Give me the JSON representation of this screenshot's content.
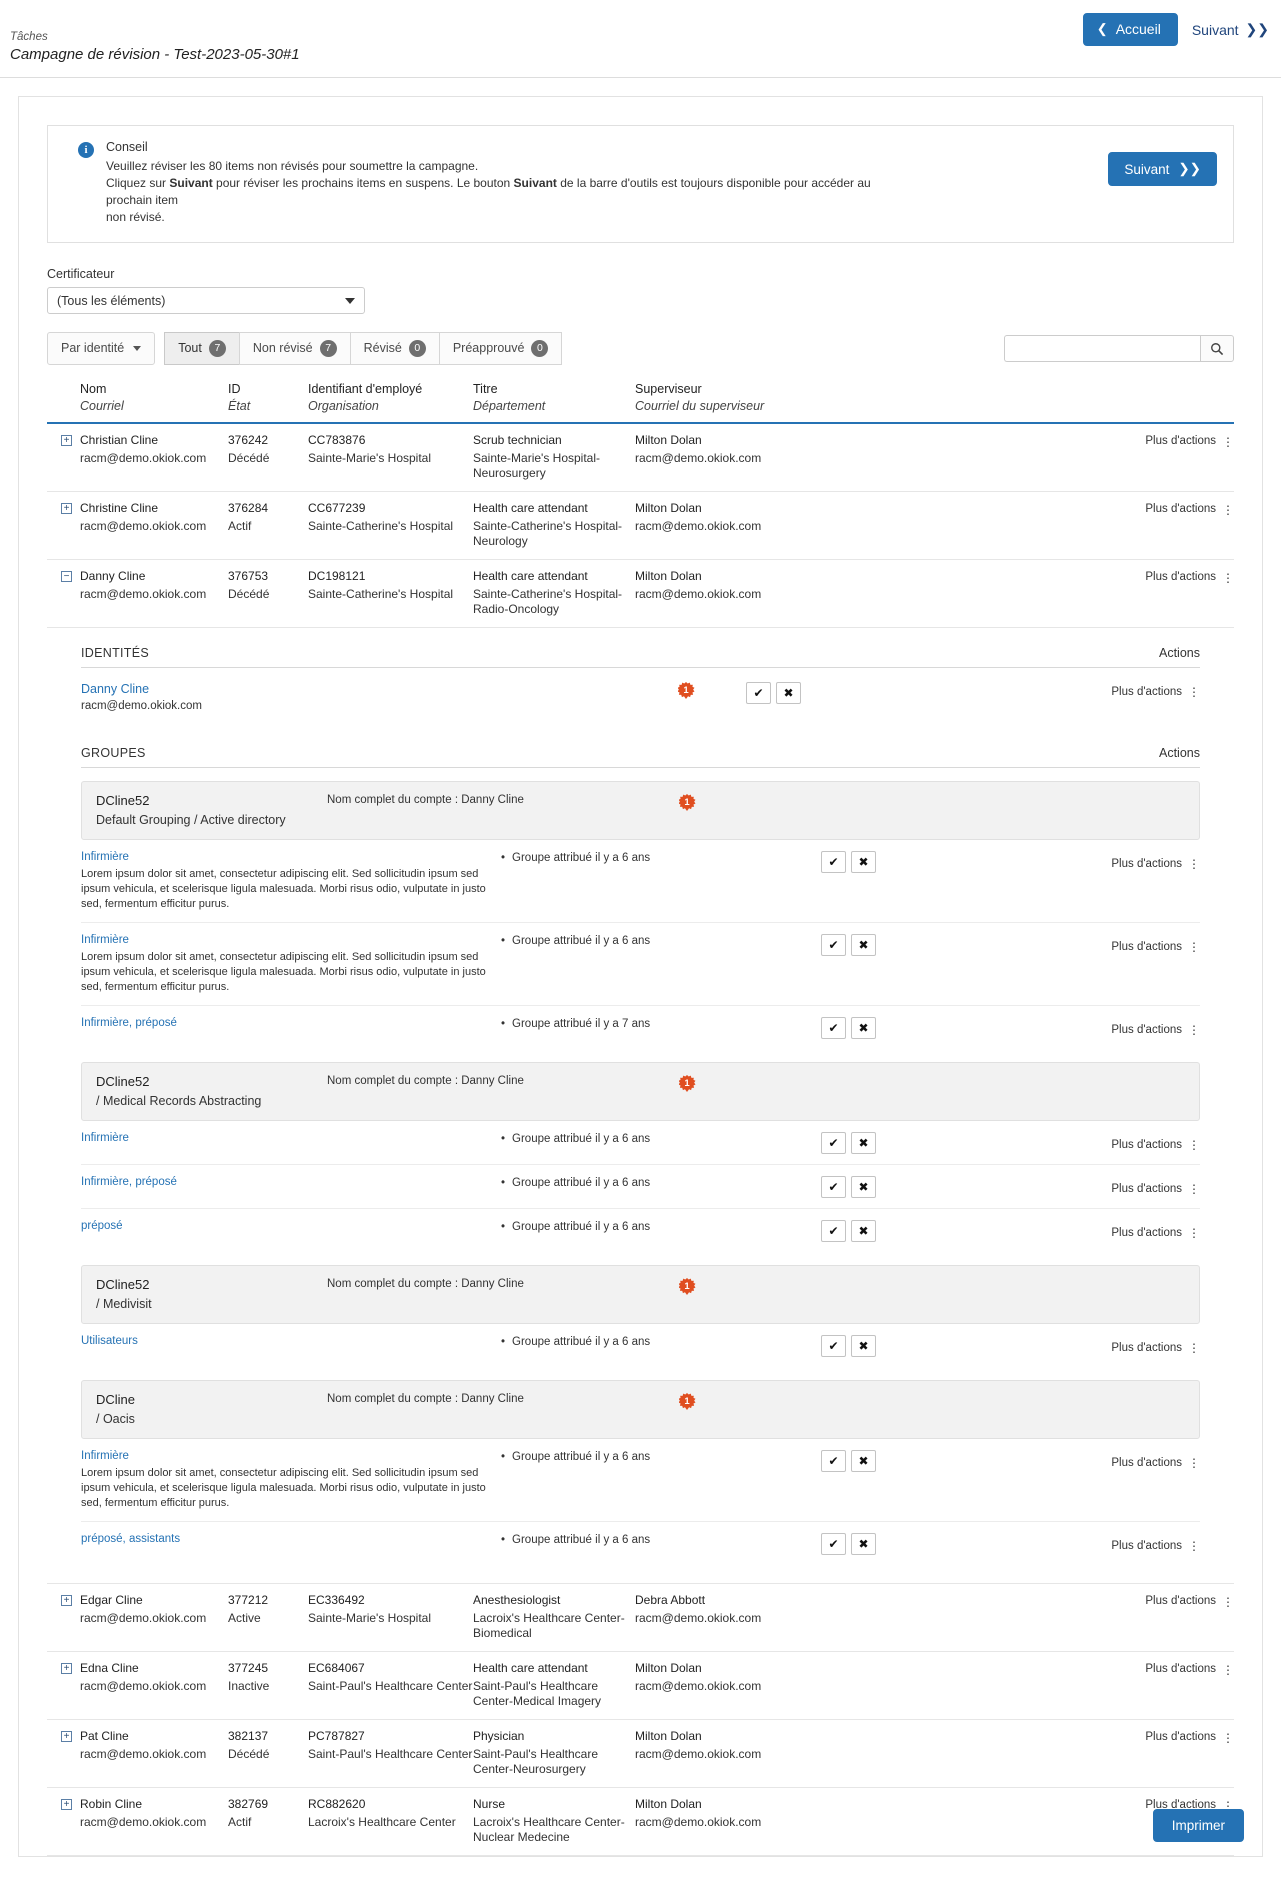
{
  "header": {
    "breadcrumb": "Tâches",
    "title": "Campagne de révision - Test-2023-05-30#1",
    "home_button": "Accueil",
    "next_link": "Suivant"
  },
  "tip": {
    "title": "Conseil",
    "line1": "Veuillez réviser les 80 items non révisés pour soumettre la campagne.",
    "line2_a": "Cliquez sur ",
    "line2_b": "Suivant",
    "line2_c": " pour réviser les prochains items en suspens. Le bouton ",
    "line2_d": "Suivant",
    "line2_e": " de la barre d'outils est toujours disponible pour accéder au prochain item",
    "line3": "non révisé.",
    "next_button": "Suivant"
  },
  "filters": {
    "certificateur_label": "Certificateur",
    "certificateur_value": "(Tous les éléments)",
    "group_tab": "Par identité",
    "tabs": [
      {
        "label": "Tout",
        "count": "7",
        "active": true
      },
      {
        "label": "Non révisé",
        "count": "7",
        "active": false
      },
      {
        "label": "Révisé",
        "count": "0",
        "active": false
      },
      {
        "label": "Préapprouvé",
        "count": "0",
        "active": false
      }
    ],
    "search_value": "",
    "search_placeholder": ""
  },
  "table": {
    "headers": {
      "nom": "Nom",
      "nom_sub": "Courriel",
      "id": "ID",
      "id_sub": "État",
      "emp": "Identifiant d'employé",
      "emp_sub": "Organisation",
      "titre": "Titre",
      "titre_sub": "Département",
      "sup": "Superviseur",
      "sup_sub": "Courriel du superviseur"
    },
    "more_actions": "Plus d'actions",
    "rows": [
      {
        "expander": "+",
        "name": "Christian Cline",
        "email": "racm@demo.okiok.com",
        "id": "376242",
        "state": "Décédé",
        "emp_id": "CC783876",
        "org": "Sainte-Marie's Hospital",
        "title": "Scrub technician",
        "dept": "Sainte-Marie's Hospital-Neurosurgery",
        "sup": "Milton Dolan",
        "sup_email": "racm@demo.okiok.com"
      },
      {
        "expander": "+",
        "name": "Christine Cline",
        "email": "racm@demo.okiok.com",
        "id": "376284",
        "state": "Actif",
        "emp_id": "CC677239",
        "org": "Sainte-Catherine's Hospital",
        "title": "Health care attendant",
        "dept": "Sainte-Catherine's Hospital-Neurology",
        "sup": "Milton Dolan",
        "sup_email": "racm@demo.okiok.com"
      },
      {
        "expander": "−",
        "name": "Danny Cline",
        "email": "racm@demo.okiok.com",
        "id": "376753",
        "state": "Décédé",
        "emp_id": "DC198121",
        "org": "Sainte-Catherine's Hospital",
        "title": "Health care attendant",
        "dept": "Sainte-Catherine's Hospital-Radio-Oncology",
        "sup": "Milton Dolan",
        "sup_email": "racm@demo.okiok.com"
      }
    ],
    "rows_after": [
      {
        "expander": "+",
        "name": "Edgar Cline",
        "email": "racm@demo.okiok.com",
        "id": "377212",
        "state": "Active",
        "emp_id": "EC336492",
        "org": "Sainte-Marie's Hospital",
        "title": "Anesthesiologist",
        "dept": "Lacroix's Healthcare Center-Biomedical",
        "sup": "Debra Abbott",
        "sup_email": "racm@demo.okiok.com"
      },
      {
        "expander": "+",
        "name": "Edna Cline",
        "email": "racm@demo.okiok.com",
        "id": "377245",
        "state": "Inactive",
        "emp_id": "EC684067",
        "org": "Saint-Paul's Healthcare Center",
        "title": "Health care attendant",
        "dept": "Saint-Paul's Healthcare Center-Medical Imagery",
        "sup": "Milton Dolan",
        "sup_email": "racm@demo.okiok.com"
      },
      {
        "expander": "+",
        "name": "Pat Cline",
        "email": "racm@demo.okiok.com",
        "id": "382137",
        "state": "Décédé",
        "emp_id": "PC787827",
        "org": "Saint-Paul's Healthcare Center",
        "title": "Physician",
        "dept": "Saint-Paul's Healthcare Center-Neurosurgery",
        "sup": "Milton Dolan",
        "sup_email": "racm@demo.okiok.com"
      },
      {
        "expander": "+",
        "name": "Robin Cline",
        "email": "racm@demo.okiok.com",
        "id": "382769",
        "state": "Actif",
        "emp_id": "RC882620",
        "org": "Lacroix's Healthcare Center",
        "title": "Nurse",
        "dept": "Lacroix's Healthcare Center-Nuclear Medecine",
        "sup": "Milton Dolan",
        "sup_email": "racm@demo.okiok.com"
      }
    ]
  },
  "detail": {
    "identities_title": "IDENTITÉS",
    "actions_title": "Actions",
    "groups_title": "GROUPES",
    "identity": {
      "name": "Danny Cline",
      "email": "racm@demo.okiok.com",
      "badge": "1",
      "approve": "✔",
      "reject": "✖",
      "more_actions": "Plus d'actions"
    },
    "account_full_name_label": "Nom complet du compte : Danny Cline",
    "lorem": "Lorem ipsum dolor sit amet, consectetur adipiscing elit. Sed sollicitudin ipsum sed ipsum vehicula, et scelerisque ligula malesuada. Morbi risus odio, vulputate in justo sed, fermentum efficitur purus.",
    "accounts": [
      {
        "name": "DCline52",
        "path": "Default Grouping / Active directory",
        "badge": "1",
        "groups": [
          {
            "name": "Infirmière",
            "desc": true,
            "meta": "Groupe attribué il y a 6 ans",
            "more": "Plus d'actions"
          },
          {
            "name": "Infirmière",
            "desc": true,
            "meta": "Groupe attribué il y a 6 ans",
            "more": "Plus d'actions"
          },
          {
            "name": "Infirmière, préposé",
            "desc": false,
            "meta": "Groupe attribué il y a 7 ans",
            "more": "Plus d'actions"
          }
        ]
      },
      {
        "name": "DCline52",
        "path": "/ Medical Records Abstracting",
        "badge": "1",
        "groups": [
          {
            "name": "Infirmière",
            "desc": false,
            "meta": "Groupe attribué il y a 6 ans",
            "more": "Plus d'actions"
          },
          {
            "name": "Infirmière, préposé",
            "desc": false,
            "meta": "Groupe attribué il y a 6 ans",
            "more": "Plus d'actions"
          },
          {
            "name": "préposé",
            "desc": false,
            "meta": "Groupe attribué il y a 6 ans",
            "more": "Plus d'actions"
          }
        ]
      },
      {
        "name": "DCline52",
        "path": "/ Medivisit",
        "badge": "1",
        "groups": [
          {
            "name": "Utilisateurs",
            "desc": false,
            "meta": "Groupe attribué il y a 6 ans",
            "more": "Plus d'actions"
          }
        ]
      },
      {
        "name": "DCline",
        "path": "/ Oacis",
        "badge": "1",
        "groups": [
          {
            "name": "Infirmière",
            "desc": true,
            "meta": "Groupe attribué il y a 6 ans",
            "more": "Plus d'actions"
          },
          {
            "name": "préposé, assistants",
            "desc": false,
            "meta": "Groupe attribué il y a 6 ans",
            "more": "Plus d'actions"
          }
        ]
      }
    ]
  },
  "footer": {
    "print_button": "Imprimer"
  },
  "colors": {
    "accent": "#2572b4",
    "badge": "#e04e20",
    "link": "#2572b4"
  }
}
